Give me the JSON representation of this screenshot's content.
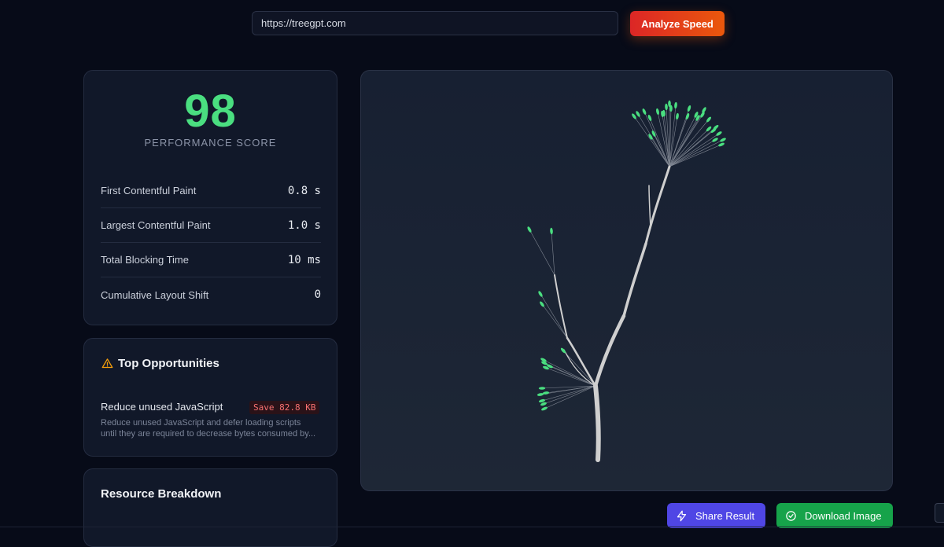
{
  "url_bar": {
    "value": "https://treegpt.com"
  },
  "analyze_button": {
    "label": "Analyze Speed"
  },
  "score": {
    "value": "98",
    "label": "PERFORMANCE SCORE"
  },
  "metrics": [
    {
      "name": "First Contentful Paint",
      "value": "0.8 s"
    },
    {
      "name": "Largest Contentful Paint",
      "value": "1.0 s"
    },
    {
      "name": "Total Blocking Time",
      "value": "10 ms"
    },
    {
      "name": "Cumulative Layout Shift",
      "value": "0"
    }
  ],
  "opportunities": {
    "title": "Top Opportunities",
    "items": [
      {
        "title": "Reduce unused JavaScript",
        "badge": "Save 82.8 KB",
        "description": "Reduce unused JavaScript and defer loading scripts until they are required to decrease bytes consumed by..."
      }
    ]
  },
  "resources": {
    "title": "Resource Breakdown"
  },
  "actions": {
    "share_label": "Share Result",
    "download_label": "Download Image"
  },
  "colors": {
    "score": "#4ade80",
    "analyze_gradient_start": "#dc2626",
    "analyze_gradient_end": "#ea580c",
    "share": "#4f46e5",
    "download": "#16a34a",
    "leaf": "#4ade80",
    "branch": "#cfcfcf"
  },
  "icons": {
    "warning": "warning-icon",
    "share": "lightning-icon",
    "download": "check-circle-icon"
  }
}
